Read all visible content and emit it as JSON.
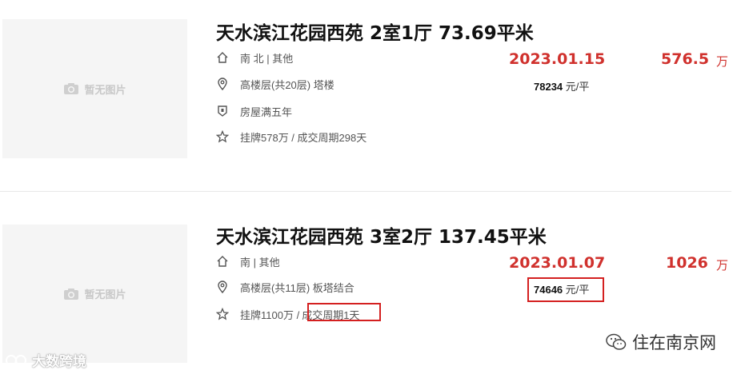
{
  "listings": [
    {
      "thumb_text": "暂无图片",
      "title": "天水滨江花园西苑 2室1厅 73.69平米",
      "orientation": "南 北 | 其他",
      "floor": "高楼层(共20层) 塔楼",
      "tag": "房屋满五年",
      "listing_cycle": "挂牌578万 / 成交周期298天",
      "deal_date": "2023.01.15",
      "unit_price_value": "78234",
      "unit_price_unit": "元/平",
      "total_price": "576.5",
      "total_unit": "万"
    },
    {
      "thumb_text": "暂无图片",
      "title": "天水滨江花园西苑 3室2厅 137.45平米",
      "orientation": "南 | 其他",
      "floor": "高楼层(共11层) 板塔结合",
      "listing_prefix": "挂牌1100万 /",
      "listing_cycle_hl": "成交周期1天",
      "deal_date": "2023.01.07",
      "unit_price_value": "74646",
      "unit_price_unit": "元/平",
      "total_price": "1026",
      "total_unit": "万"
    }
  ],
  "watermarks": {
    "left": "大数跨境",
    "right": "住在南京网"
  },
  "colors": {
    "accent_red": "#d0312d",
    "highlight_box": "#d42020"
  }
}
